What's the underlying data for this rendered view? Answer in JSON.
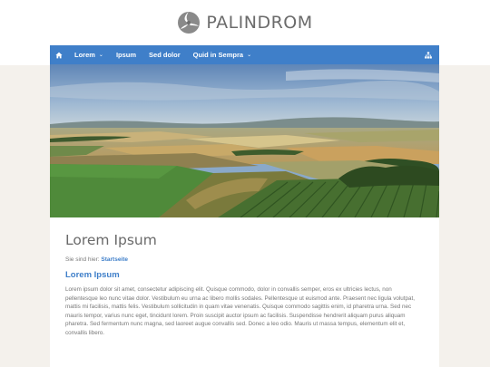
{
  "brand": {
    "name": "PALINDROM"
  },
  "nav": {
    "home_icon": "home-icon",
    "items": [
      {
        "label": "Lorem",
        "has_dropdown": true
      },
      {
        "label": "Ipsum",
        "has_dropdown": false
      },
      {
        "label": "Sed dolor",
        "has_dropdown": false
      },
      {
        "label": "Quid in Sempra",
        "has_dropdown": true
      }
    ],
    "right_icon": "sitemap-icon",
    "color": "#3f7fc9"
  },
  "hero": {
    "image": "aerial-farmland-landscape"
  },
  "content": {
    "title": "Lorem Ipsum",
    "breadcrumb_prefix": "Sie sind hier:",
    "breadcrumb_link": "Startseite",
    "section_title": "Lorem Ipsum",
    "body": "Lorem ipsum dolor sit amet, consectetur adipiscing elit. Quisque commodo, dolor in convallis semper, eros ex ultricies lectus, non pellentesque leo nunc vitae dolor. Vestibulum eu urna ac libero mollis sodales. Pellentesque ut euismod ante. Praesent nec ligula volutpat, mattis mi facilisis, mattis felis. Vestibulum sollicitudin in quam vitae venenatis. Quisque commodo sagittis enim, id pharetra urna. Sed nec mauris tempor, varius nunc eget, tincidunt lorem. Proin suscipit auctor ipsum ac facilisis. Suspendisse hendrerit aliquam purus aliquam pharetra. Sed fermentum nunc magna, sed laoreet augue convallis sed. Donec a leo odio. Mauris ut massa tempus, elementum elit et, convallis libero."
  }
}
